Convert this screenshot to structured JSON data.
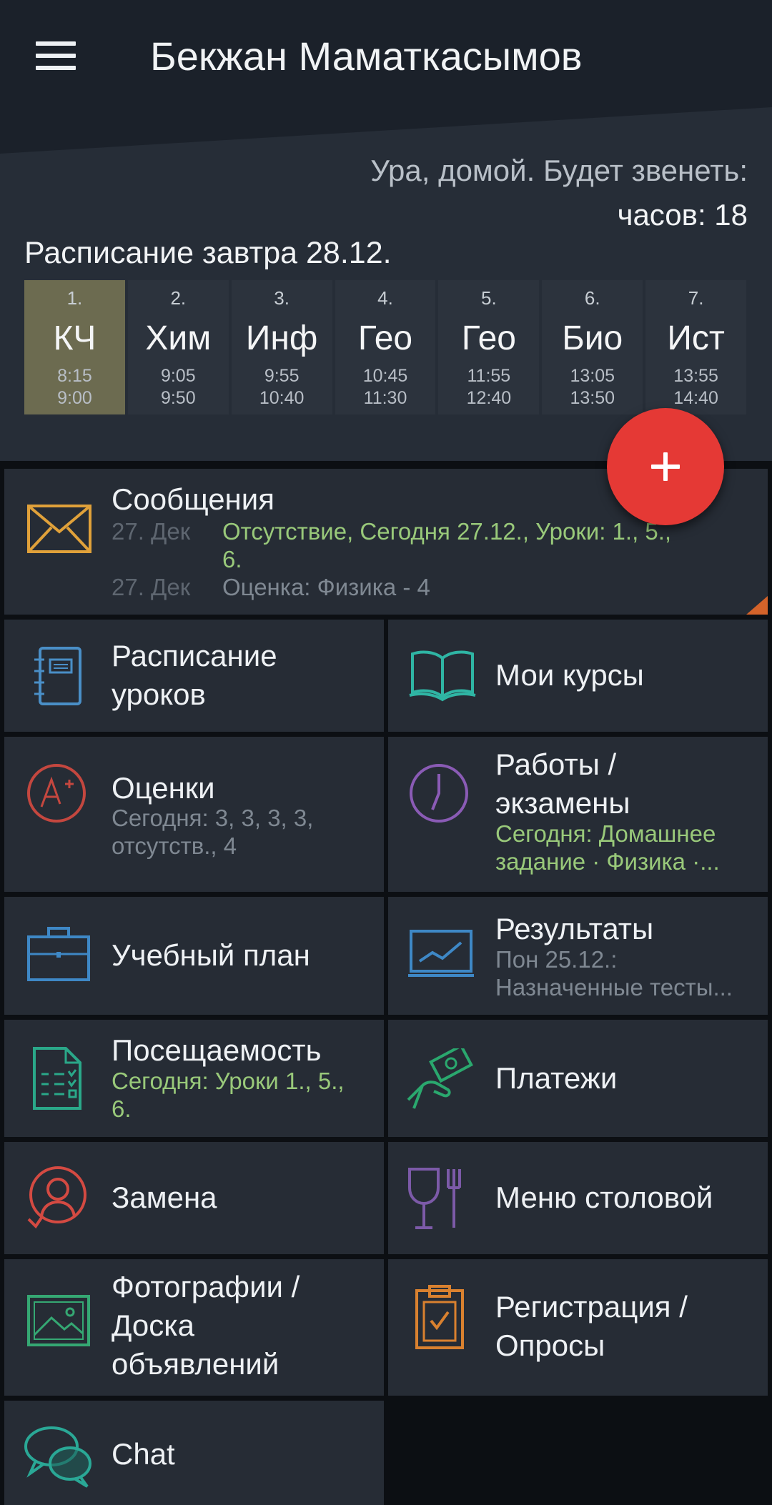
{
  "app_bar": {
    "title": "Бекжан Маматкасымов"
  },
  "bell": {
    "line1": "Ура, домой. Будет звенеть:",
    "line2": "часов: 18"
  },
  "schedule": {
    "title": "Расписание завтра 28.12.",
    "lessons": [
      {
        "num": "1.",
        "name": "КЧ",
        "start": "8:15",
        "end": "9:00"
      },
      {
        "num": "2.",
        "name": "Хим",
        "start": "9:05",
        "end": "9:50"
      },
      {
        "num": "3.",
        "name": "Инф",
        "start": "9:55",
        "end": "10:40"
      },
      {
        "num": "4.",
        "name": "Гео",
        "start": "10:45",
        "end": "11:30"
      },
      {
        "num": "5.",
        "name": "Гео",
        "start": "11:55",
        "end": "12:40"
      },
      {
        "num": "6.",
        "name": "Био",
        "start": "13:05",
        "end": "13:50"
      },
      {
        "num": "7.",
        "name": "Ист",
        "start": "13:55",
        "end": "14:40"
      }
    ]
  },
  "messages": {
    "label": "Сообщения",
    "items": [
      {
        "date": "27. Дек",
        "text": "Отсутствие, Сегодня 27.12., Уроки: 1., 5.,\n6."
      },
      {
        "date": "27. Дек",
        "text": "Оценка: Физика - 4"
      }
    ]
  },
  "tiles": {
    "timetable": {
      "label": "Расписание\nуроков"
    },
    "courses": {
      "label": "Мои курсы"
    },
    "grades": {
      "label": "Оценки",
      "sub": "Сегодня: 3, 3, 3, 3,\nотсутств., 4"
    },
    "exams": {
      "label": "Работы /\nэкзамены",
      "sub": "Сегодня: Домашнее\nзадание · Физика ·..."
    },
    "curriculum": {
      "label": "Учебный план"
    },
    "results": {
      "label": "Результаты",
      "sub": "Пон 25.12.:\nНазначенные тесты..."
    },
    "attendance": {
      "label": "Посещаемость",
      "sub": "Сегодня: Уроки 1., 5.,\n6."
    },
    "payments": {
      "label": "Платежи"
    },
    "substitution": {
      "label": "Замена"
    },
    "canteen": {
      "label": "Меню столовой"
    },
    "photos": {
      "label": "Фотографии /\nДоска\nобъявлений"
    },
    "registration": {
      "label": "Регистрация /\nОпросы"
    },
    "chat": {
      "label": "Chat"
    }
  },
  "icons": {
    "menu": "hamburger-menu-icon",
    "messages": "envelope-icon",
    "timetable": "notebook-icon",
    "courses": "open-book-icon",
    "grades": "grade-a-plus-icon",
    "exams": "clock-icon",
    "curriculum": "briefcase-icon",
    "results": "chart-board-icon",
    "attendance": "checklist-document-icon",
    "payments": "hand-money-icon",
    "substitution": "person-swap-icon",
    "canteen": "glass-fork-icon",
    "photos": "picture-icon",
    "registration": "clipboard-check-icon",
    "chat": "chat-bubbles-icon",
    "fab": "plus-icon"
  },
  "colors": {
    "envelope": "#e0a13a",
    "notebook": "#4a8fc7",
    "book": "#2fb5a4",
    "grades": "#c4473f",
    "clock": "#8a5bb5",
    "briefcase": "#3e88c6",
    "chart": "#3e88c6",
    "attendance": "#2aa889",
    "payments": "#2aa86e",
    "substitution": "#d44a42",
    "canteen": "#7c5aa8",
    "photos": "#35a873",
    "clipboard": "#d9812f",
    "chat": "#2aa896",
    "fab": "#e53935",
    "active_lesson": "#6c6b50"
  }
}
